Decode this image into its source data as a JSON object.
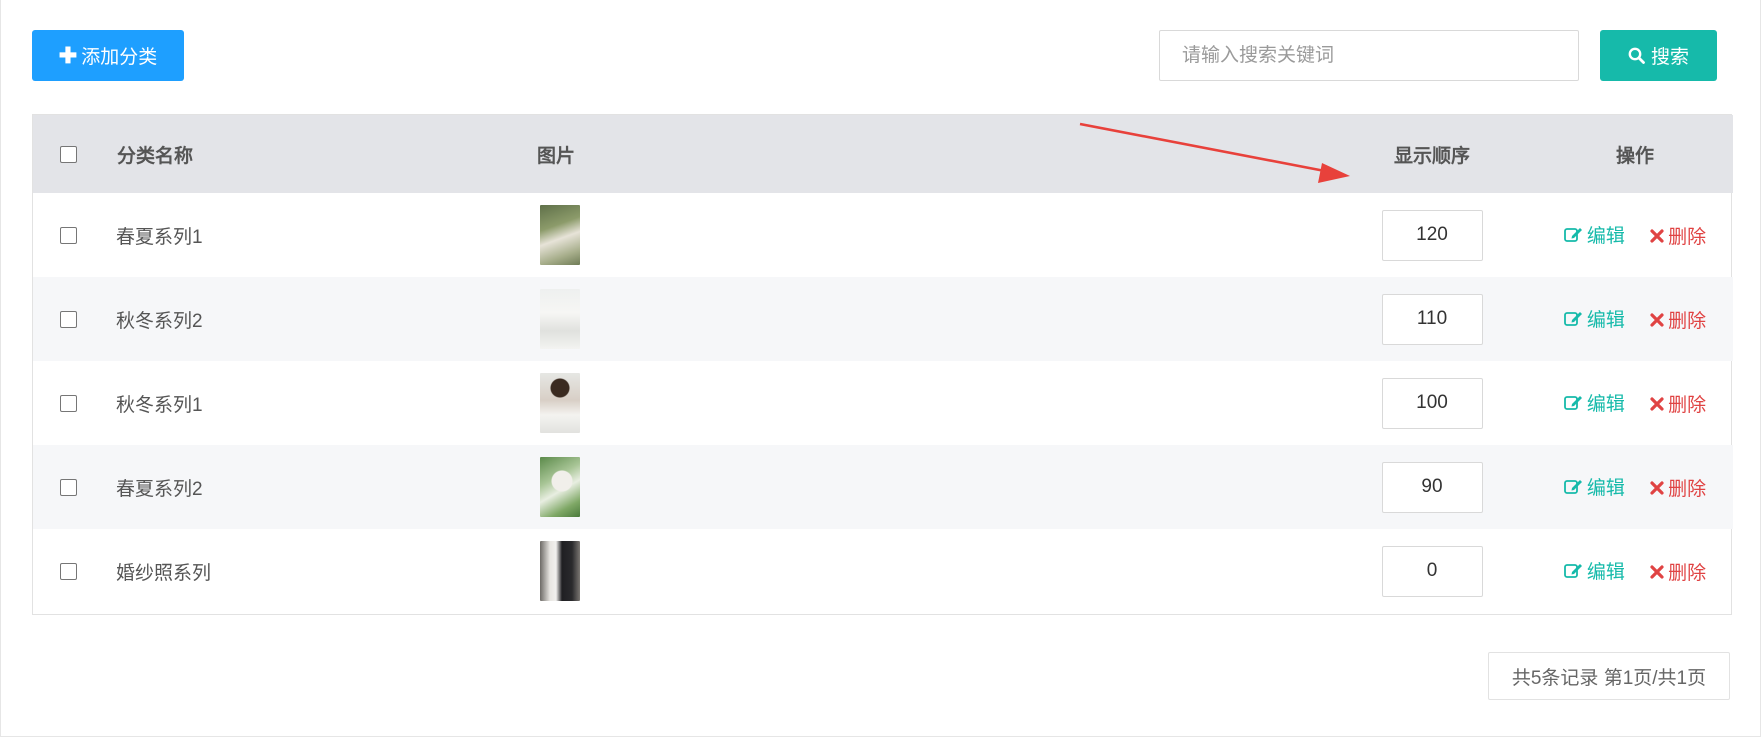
{
  "toolbar": {
    "add_label": "添加分类",
    "search_placeholder": "请输入搜索关键词",
    "search_label": "搜索"
  },
  "table": {
    "headers": {
      "name": "分类名称",
      "image": "图片",
      "order": "显示顺序",
      "ops": "操作"
    },
    "rows": [
      {
        "name": "春夏系列1",
        "order": "120"
      },
      {
        "name": "秋冬系列2",
        "order": "110"
      },
      {
        "name": "秋冬系列1",
        "order": "100"
      },
      {
        "name": "春夏系列2",
        "order": "90"
      },
      {
        "name": "婚纱照系列",
        "order": "0"
      }
    ],
    "edit_label": "编辑",
    "delete_label": "删除"
  },
  "pager": {
    "text": "共5条记录 第1页/共1页"
  },
  "colors": {
    "primary_blue": "#1e9fff",
    "teal": "#16baaa",
    "danger": "#e04343",
    "annotation_arrow": "#e8413b"
  },
  "icons": {
    "add": "plus-icon",
    "search": "search-icon",
    "edit": "edit-icon",
    "delete": "close-icon"
  }
}
